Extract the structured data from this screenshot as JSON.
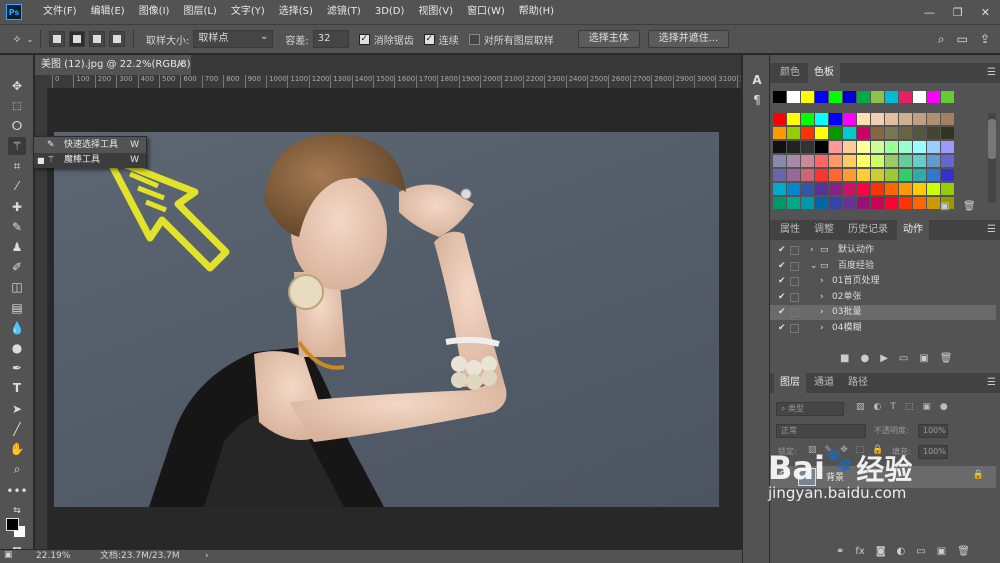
{
  "app": {
    "logo": "Ps"
  },
  "menu": [
    "文件(F)",
    "编辑(E)",
    "图像(I)",
    "图层(L)",
    "文字(Y)",
    "选择(S)",
    "滤镜(T)",
    "3D(D)",
    "视图(V)",
    "窗口(W)",
    "帮助(H)"
  ],
  "window_controls": {
    "minimize": "—",
    "restore": "❐",
    "close": "✕"
  },
  "options": {
    "tool_icon": "magic-wand-icon",
    "sample_size_label": "取样大小:",
    "sample_size_value": "取样点",
    "tolerance_label": "容差:",
    "tolerance_value": "32",
    "antialias_label": "消除锯齿",
    "contiguous_label": "连续",
    "all_layers_label": "对所有图层取样",
    "select_subject": "选择主体",
    "select_mask": "选择并遮住..."
  },
  "document": {
    "tab_title": "美图 (12).jpg @ 22.2%(RGB/8)",
    "tab_close": "×"
  },
  "ruler": [
    "0",
    "100",
    "200",
    "300",
    "400",
    "500",
    "600",
    "700",
    "800",
    "900",
    "1000",
    "1100",
    "1200",
    "1300",
    "1400",
    "1500",
    "1600",
    "1700",
    "1800",
    "1900",
    "2000",
    "2100",
    "2200",
    "2300",
    "2400",
    "2500",
    "2600",
    "2700",
    "2800",
    "2900",
    "3000",
    "3100",
    "3200"
  ],
  "status": {
    "zoom": "22.19%",
    "doc": "文档:23.7M/23.7M",
    "arrow": "›"
  },
  "flyout": {
    "items": [
      {
        "label": "快速选择工具",
        "key": "W",
        "active": false
      },
      {
        "label": "魔棒工具",
        "key": "W",
        "active": true
      }
    ]
  },
  "panels": {
    "color_tabs": [
      "颜色",
      "色板"
    ],
    "adjust_tabs": [
      "属性",
      "调整",
      "历史记录",
      "动作"
    ],
    "layers_tabs": [
      "图层",
      "通道",
      "路径"
    ],
    "actions": [
      {
        "label": "默认动作",
        "indent": 0,
        "folder": true,
        "open": false,
        "selected": false
      },
      {
        "label": "百度经验",
        "indent": 0,
        "folder": true,
        "open": true,
        "selected": false
      },
      {
        "label": "01首页处理",
        "indent": 1,
        "folder": false,
        "open": false,
        "selected": false
      },
      {
        "label": "02单张",
        "indent": 1,
        "folder": false,
        "open": false,
        "selected": false
      },
      {
        "label": "03批量",
        "indent": 1,
        "folder": false,
        "open": false,
        "selected": true
      },
      {
        "label": "04模糊",
        "indent": 1,
        "folder": false,
        "open": false,
        "selected": false
      }
    ],
    "layers": {
      "filter_label": "类型",
      "blend_mode": "正常",
      "opacity_label": "不透明度:",
      "opacity_value": "100%",
      "lock_label": "锁定:",
      "fill_label": "填充:",
      "fill_value": "100%",
      "layer_name": "背景"
    }
  },
  "swatches": [
    [
      "#000000",
      "#ffffff",
      "#ffff00",
      "#0000ff",
      "#00ff00",
      "#0000cc",
      "#00aa44",
      "#8bc34a",
      "#00bcd4",
      "#e91e63",
      "#ffffff",
      "#ff00ff",
      "#66cc33"
    ],
    [
      "#ff0000",
      "#ffff00",
      "#00ff00",
      "#00ffff",
      "#0000ff",
      "#ff00ff",
      "#ffe0b0",
      "#f0d0b0",
      "#e0c0a0",
      "#d0b090",
      "#c0a080",
      "#b09070",
      "#a08060"
    ],
    [
      "#ff9900",
      "#99cc00",
      "#ff3300",
      "#ffff00",
      "#009900",
      "#00cccc",
      "#cc0066",
      "#886644",
      "#777755",
      "#666644",
      "#555544",
      "#444433",
      "#333322"
    ],
    [
      "#111111",
      "#222222",
      "#333333",
      "#000000",
      "#ff9999",
      "#ffcc99",
      "#ffff99",
      "#ccff99",
      "#99ff99",
      "#99ffcc",
      "#99ffff",
      "#99ccff",
      "#9999ff"
    ],
    [
      "#8888aa",
      "#aa88aa",
      "#cc8899",
      "#ff6666",
      "#ff9966",
      "#ffcc66",
      "#ffff66",
      "#ccff66",
      "#99cc66",
      "#66cc99",
      "#66cccc",
      "#6699cc",
      "#6666cc"
    ],
    [
      "#6666aa",
      "#996699",
      "#cc6677",
      "#ff3333",
      "#ff6633",
      "#ff9933",
      "#ffcc33",
      "#cccc33",
      "#99cc33",
      "#33cc66",
      "#33aaaa",
      "#3377cc",
      "#3333cc"
    ],
    [
      "#00aacc",
      "#0088cc",
      "#3355aa",
      "#553399",
      "#882288",
      "#cc1166",
      "#ff0044",
      "#ff3300",
      "#ff6600",
      "#ff9900",
      "#ffcc00",
      "#ccff00",
      "#99cc00"
    ],
    [
      "#009966",
      "#00aa88",
      "#0099aa",
      "#0066aa",
      "#3344aa",
      "#663399",
      "#991177",
      "#cc0055",
      "#ff0033",
      "#ff3300",
      "#ff6600",
      "#cc9900",
      "#999900"
    ]
  ],
  "watermark": {
    "brand_1": "Bai",
    "brand_2": "经验",
    "paw": "🐾",
    "url": "jingyan.baidu.com"
  },
  "colors": {
    "chrome": "#535353",
    "dark": "#282828",
    "arrow": "#e2e22a"
  }
}
